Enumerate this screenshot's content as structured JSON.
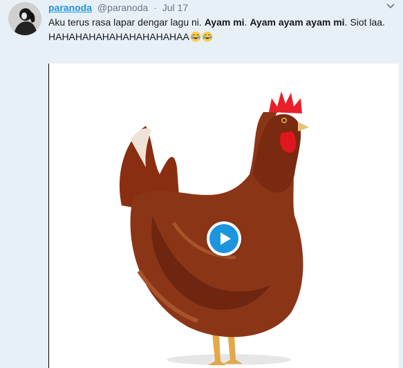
{
  "tweet": {
    "display_name": "paranoda",
    "handle": "@paranoda",
    "separator": "·",
    "timestamp": "Jul 17",
    "text_parts": {
      "intro": "Aku terus rasa lapar dengar lagu ni. ",
      "bold_1": "Ayam mi",
      "mid_1": ". ",
      "bold_2": "Ayam ayam ayam mi",
      "tail": ". Siot laa.",
      "laugh": "HAHAHAHAHAHAHAHAHAHAA"
    },
    "emojis": [
      "face-with-tears-of-joy-icon",
      "face-with-tears-of-joy-icon"
    ]
  },
  "media": {
    "subject": "chicken-image",
    "play_icon": "play-icon"
  },
  "colors": {
    "accent": "#1b95e0",
    "muted": "#657786",
    "page_background": "#e8f0f7"
  }
}
